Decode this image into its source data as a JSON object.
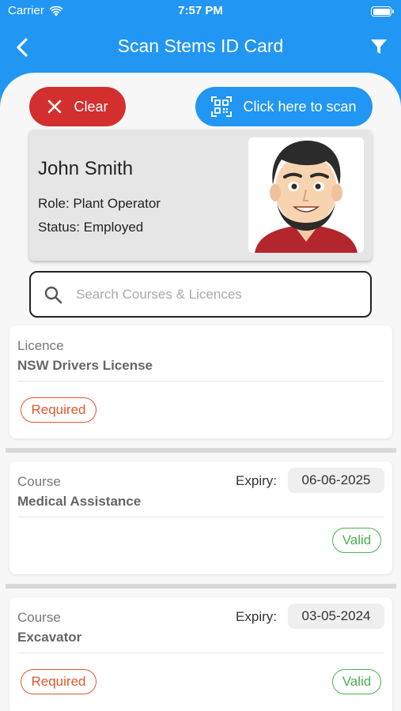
{
  "status_bar": {
    "carrier": "Carrier",
    "time": "7:57 PM"
  },
  "nav": {
    "title": "Scan Stems ID Card",
    "back_icon": "chevron-left-icon",
    "filter_icon": "filter-icon"
  },
  "actions": {
    "clear_label": "Clear",
    "scan_label": "Click here to scan"
  },
  "id_card": {
    "name": "John Smith",
    "role": "Role: Plant Operator",
    "status": "Status: Employed"
  },
  "search": {
    "placeholder": "Search Courses & Licences",
    "value": ""
  },
  "items": [
    {
      "type": "Licence",
      "name": "NSW Drivers License",
      "badge": "Required"
    },
    {
      "type": "Course",
      "name": "Medical Assistance",
      "expiry_label": "Expiry:",
      "expiry_date": "06-06-2025",
      "badge": "Valid"
    },
    {
      "type": "Course",
      "name": "Excavator",
      "expiry_label": "Expiry:",
      "expiry_date": "03-05-2024",
      "badges": [
        "Required",
        "Valid"
      ]
    }
  ],
  "colors": {
    "primary": "#2196f3",
    "danger": "#d32f2f",
    "required": "#e2572b",
    "valid": "#4caf50"
  }
}
